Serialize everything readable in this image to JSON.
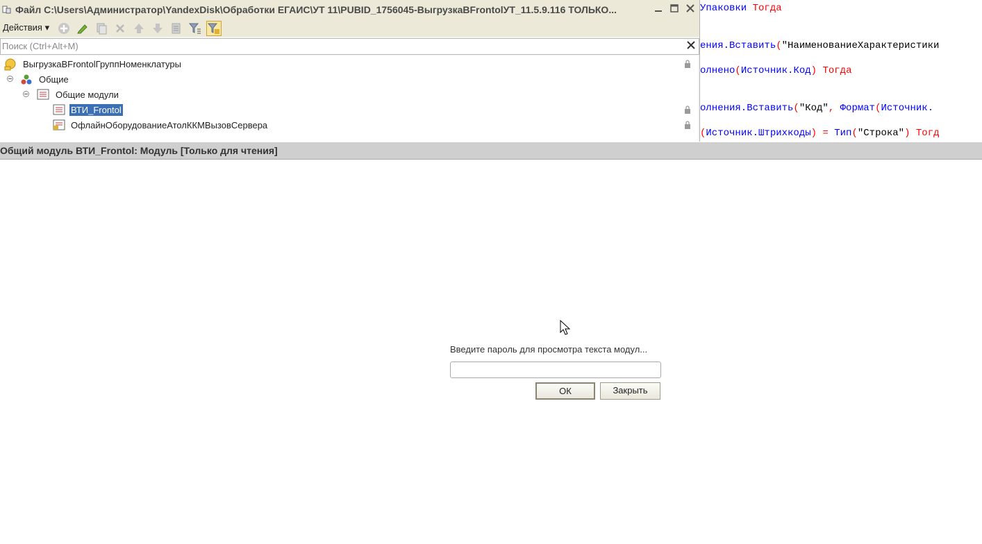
{
  "code_editor": {
    "lines": [
      {
        "parts": [
          {
            "text": "Упаковки ",
            "cls": "id"
          },
          {
            "text": "Тогда",
            "cls": "kw"
          }
        ]
      },
      {
        "parts": [
          {
            "text": "ения.Вставить",
            "cls": "id"
          },
          {
            "text": "(",
            "cls": "op"
          },
          {
            "text": "\"НаименованиеХарактеристики",
            "cls": "str"
          }
        ]
      },
      {
        "parts": [
          {
            "text": "олнено",
            "cls": "id"
          },
          {
            "text": "(",
            "cls": "op"
          },
          {
            "text": "Источник.Код",
            "cls": "id"
          },
          {
            "text": ") ",
            "cls": "op"
          },
          {
            "text": "Тогда",
            "cls": "kw"
          }
        ]
      },
      {
        "parts": [
          {
            "text": "олнения.Вставить",
            "cls": "id"
          },
          {
            "text": "(",
            "cls": "op"
          },
          {
            "text": "\"Код\"",
            "cls": "str"
          },
          {
            "text": ", ",
            "cls": "op"
          },
          {
            "text": "Формат",
            "cls": "id"
          },
          {
            "text": "(",
            "cls": "op"
          },
          {
            "text": "Источник.",
            "cls": "id"
          }
        ]
      },
      {
        "parts": [
          {
            "text": "(",
            "cls": "op"
          },
          {
            "text": "Источник.Штрихкоды",
            "cls": "id"
          },
          {
            "text": ") = ",
            "cls": "op"
          },
          {
            "text": "Тип",
            "cls": "id"
          },
          {
            "text": "(",
            "cls": "op"
          },
          {
            "text": "\"Строка\"",
            "cls": "str"
          },
          {
            "text": ") ",
            "cls": "op"
          },
          {
            "text": "Тогд",
            "cls": "kw"
          }
        ]
      }
    ]
  },
  "window": {
    "title": "Файл C:\\Users\\Администратор\\YandexDisk\\Обработки ЕГАИС\\УТ 11\\PUBID_1756045-ВыгрузкаВFrontolУТ_11.5.9.116 ТОЛЬКО..."
  },
  "toolbar": {
    "actions_label": "Действия ▾"
  },
  "search": {
    "placeholder": "Поиск (Ctrl+Alt+M)",
    "value": ""
  },
  "tree": {
    "root": "ВыгрузкаВFrontolГруппНоменклатуры",
    "common": "Общие",
    "common_modules": "Общие модули",
    "module_1": "ВТИ_Frontol",
    "module_2": "ОфлайнОборудованиеАтолККМВызовСервера"
  },
  "module_panel": {
    "title": "Общий модуль ВТИ_Frontol: Модуль [Только для чтения]",
    "prompt": "Введите пароль для просмотра текста модул...",
    "password_value": "",
    "ok_label": "ОК",
    "close_label": "Закрыть"
  },
  "colors": {
    "keyword": "#ff0000",
    "identifier": "#0000ff",
    "selection": "#3b6fb6",
    "panel_header": "#cfcfcf",
    "window_chrome": "#ece9d8"
  }
}
